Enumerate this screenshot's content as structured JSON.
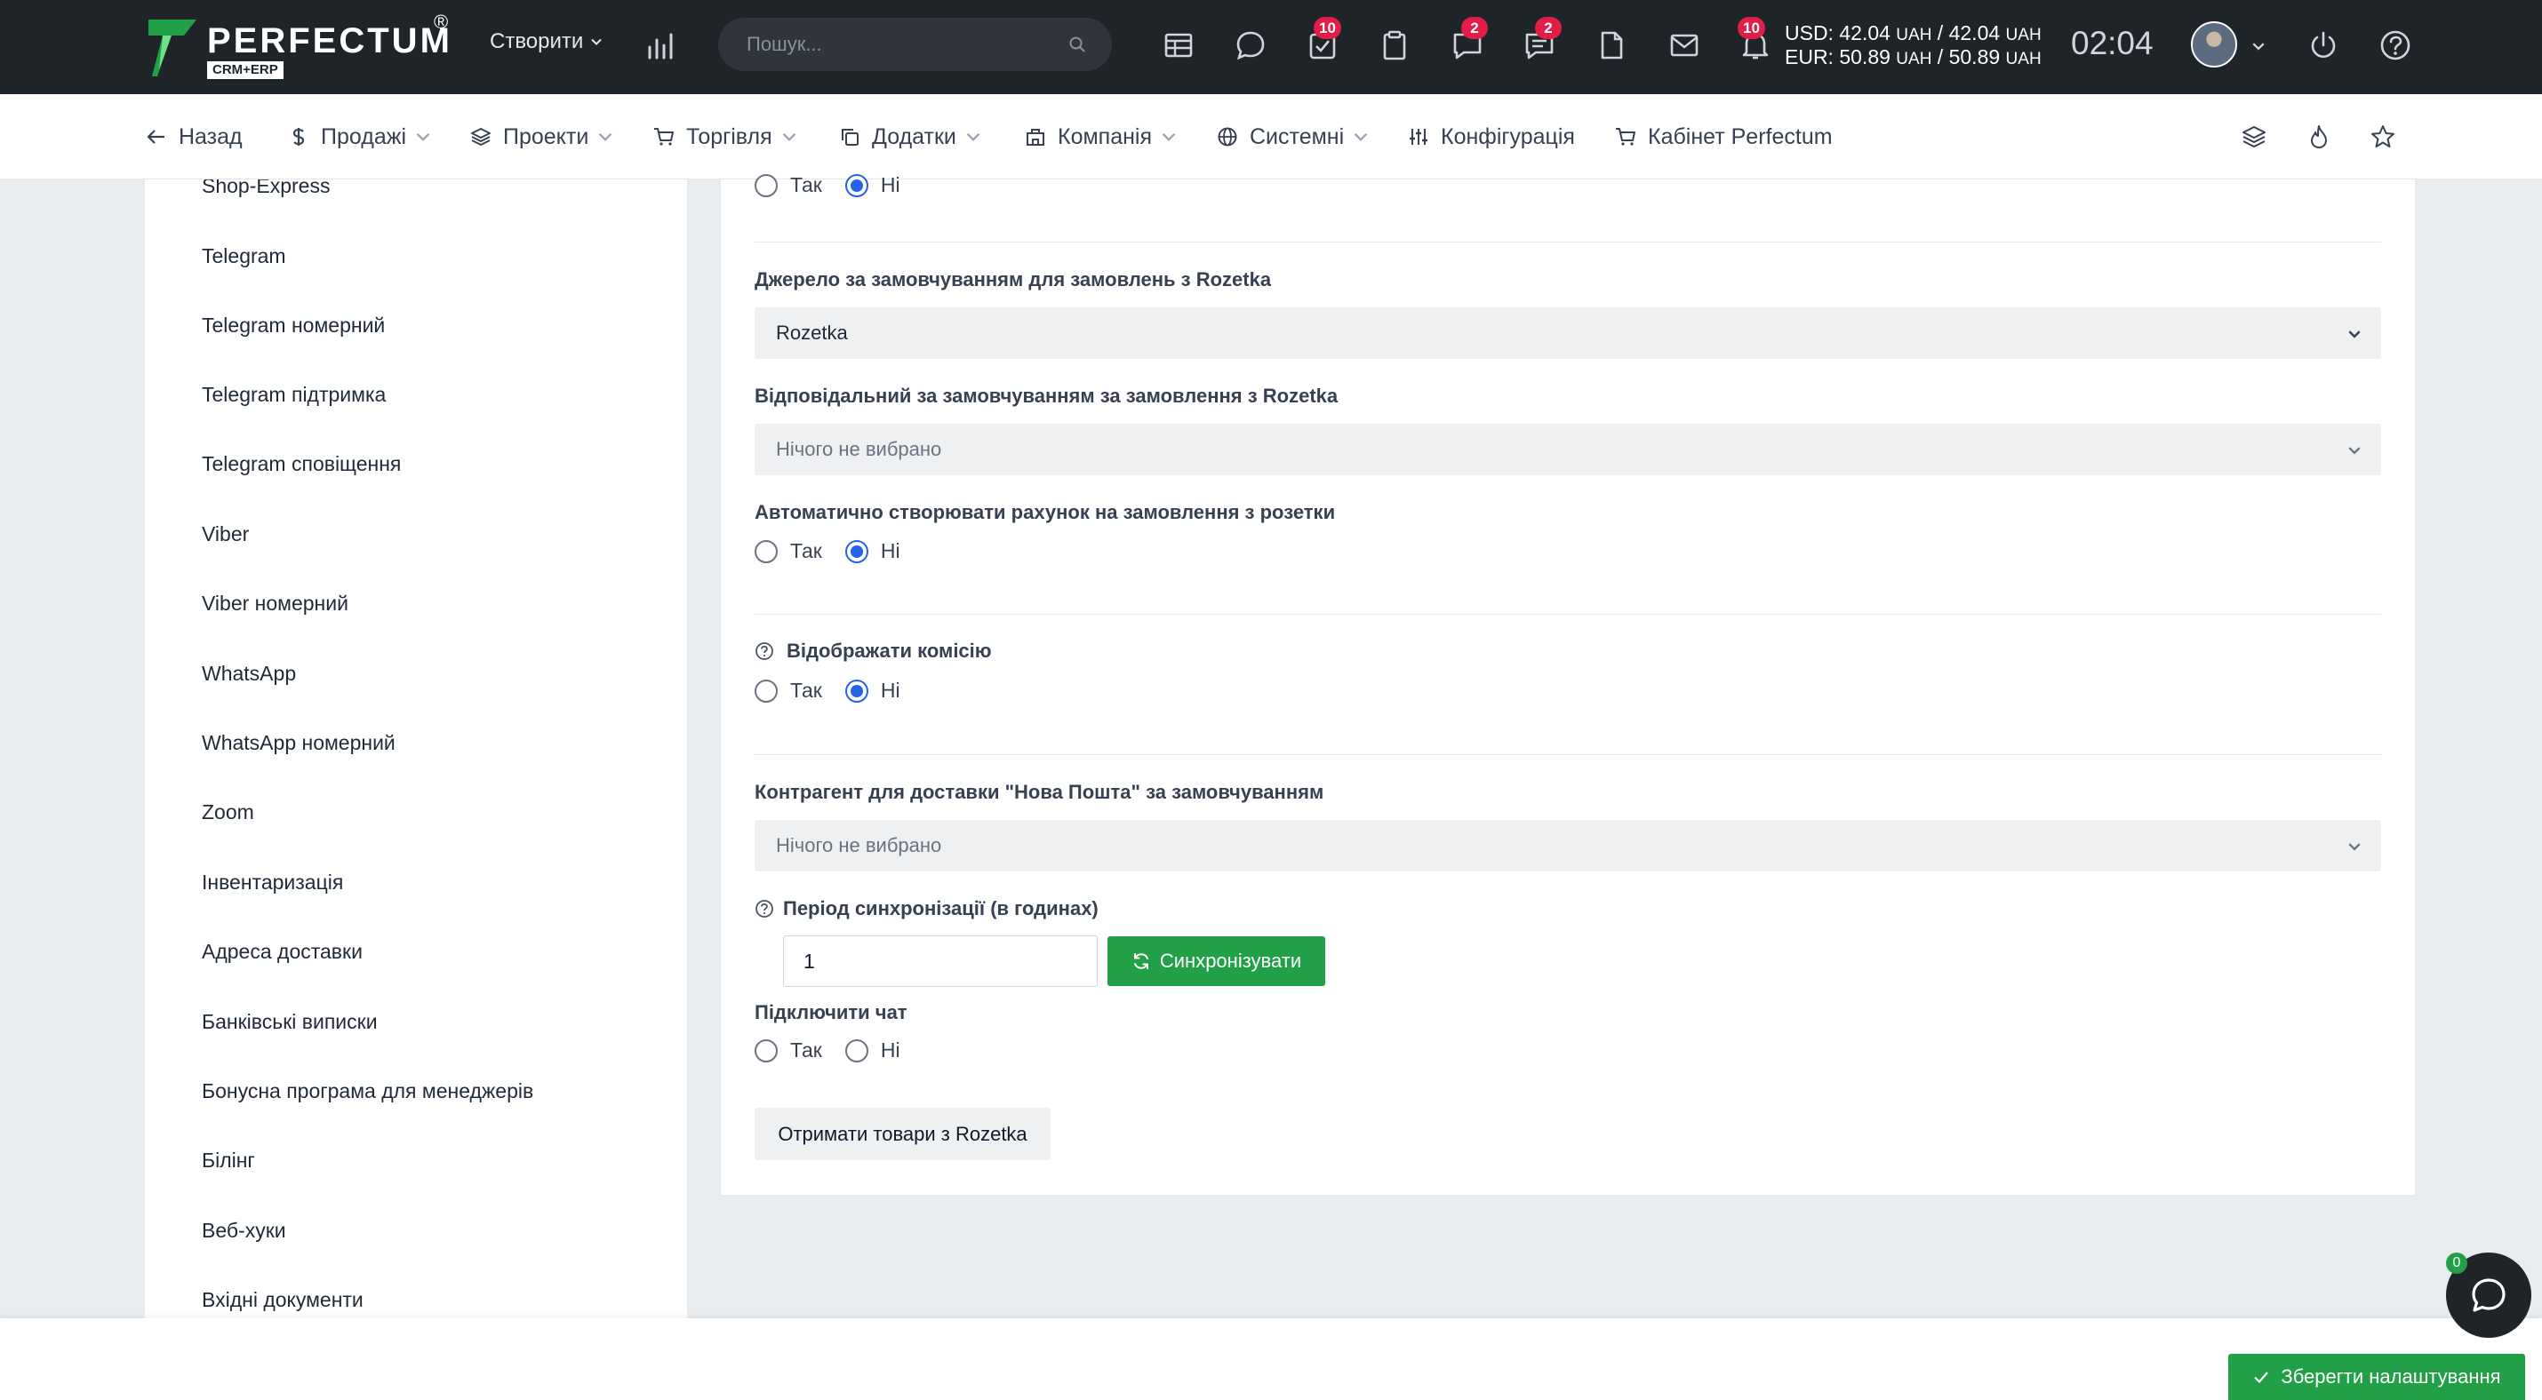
{
  "brand": {
    "name": "PERFECTUM",
    "reg": "®",
    "sub": "CRM+ERP"
  },
  "topbar": {
    "create_label": "Створити",
    "search_placeholder": "Пошук...",
    "badges": {
      "tasks": "10",
      "chat": "2",
      "comments": "2",
      "notifications": "10"
    },
    "currency": {
      "usd": "USD: 42.04",
      "usd_unit": "UAH",
      "usd_sep": " / 42.04",
      "eur": "EUR: 50.89",
      "eur_unit": "UAH",
      "eur_sep": " / 50.89"
    },
    "clock": "02:04"
  },
  "nav": {
    "back": "Назад",
    "sales": "Продажі",
    "projects": "Проекти",
    "trade": "Торгівля",
    "addons": "Додатки",
    "company": "Компанія",
    "system": "Системні",
    "config": "Конфігурація",
    "cabinet": "Кабінет Perfectum"
  },
  "sidebar": {
    "items": [
      "Shop-Express",
      "Telegram",
      "Telegram номерний",
      "Telegram підтримка",
      "Telegram сповіщення",
      "Viber",
      "Viber номерний",
      "WhatsApp",
      "WhatsApp номерний",
      "Zoom",
      "Інвентаризація",
      "Адреса доставки",
      "Банківські виписки",
      "Бонусна програма для менеджерів",
      "Білінг",
      "Веб-хуки",
      "Вхідні документи"
    ]
  },
  "form": {
    "yes": "Так",
    "no": "Ні",
    "source_label": "Джерело за замовчуванням для замовлень з Rozetka",
    "source_value": "Rozetka",
    "responsible_label": "Відповідальний за замовчуванням за замовлення з Rozetka",
    "nothing_selected": "Нічого не вибрано",
    "auto_invoice_label": "Автоматично створювати рахунок на замовлення з розетки",
    "commission_label": "Відображати комісію",
    "np_label": "Контрагент для доставки \"Нова Пошта\" за замовчуванням",
    "sync_period_label": "Період синхронізації (в годинах)",
    "sync_period_value": "1",
    "sync_button": "Синхронізувати",
    "chat_label": "Підключити чат",
    "get_products_button": "Отримати товари з Rozetka"
  },
  "footer": {
    "save_button": "Зберегти налаштування",
    "chat_badge": "0"
  }
}
